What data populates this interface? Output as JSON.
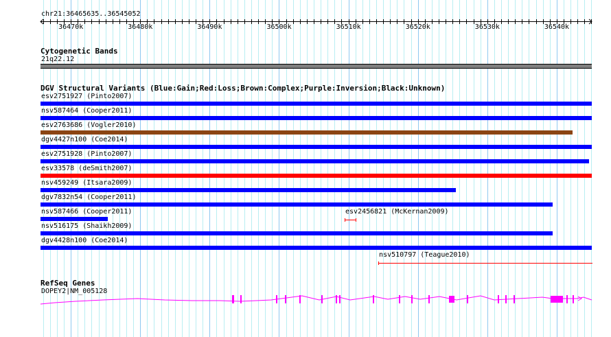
{
  "ruler": {
    "location": "chr21:36465635..36545052",
    "start": 36465635,
    "end": 36545052,
    "ticks": [
      "36470k",
      "36480k",
      "36490k",
      "36500k",
      "36510k",
      "36520k",
      "36530k",
      "36540k"
    ]
  },
  "cyto": {
    "title": "Cytogenetic Bands",
    "band": "21q22.12",
    "color": "#808080"
  },
  "dgv": {
    "title": "DGV Structural Variants (Blue:Gain;Red:Loss;Brown:Complex;Purple:Inversion;Black:Unknown)",
    "colors": {
      "gain": "#0000ff",
      "loss": "#ff0000",
      "complex": "#8b4513"
    },
    "variants": [
      {
        "label": "esv2751927 (Pinto2007)",
        "type": "gain",
        "start": 36465635,
        "end": 36545052,
        "row": 0
      },
      {
        "label": "nsv587464 (Cooper2011)",
        "type": "gain",
        "start": 36465635,
        "end": 36545052,
        "row": 1
      },
      {
        "label": "esv2763686 (Vogler2010)",
        "type": "complex",
        "start": 36465635,
        "end": 36542290,
        "row": 2
      },
      {
        "label": "dgv4427n100 (Coe2014)",
        "type": "gain",
        "start": 36465635,
        "end": 36545052,
        "row": 3
      },
      {
        "label": "esv2751928 (Pinto2007)",
        "type": "gain",
        "start": 36465635,
        "end": 36544660,
        "row": 4
      },
      {
        "label": "esv33578 (deSmith2007)",
        "type": "loss",
        "start": 36465635,
        "end": 36545052,
        "row": 5
      },
      {
        "label": "nsv459249 (Itsara2009)",
        "type": "gain",
        "start": 36465635,
        "end": 36525480,
        "row": 6
      },
      {
        "label": "dgv7832n54 (Cooper2011)",
        "type": "gain",
        "start": 36465635,
        "end": 36539420,
        "row": 7
      },
      {
        "label": "nsv587466 (Cooper2011)",
        "type": "gain",
        "start": 36465635,
        "end": 36475330,
        "row": 8
      },
      {
        "label": "esv2456821 (McKernan2009)",
        "type": "loss",
        "start": 36509450,
        "end": 36510940,
        "row": 8,
        "thin": true
      },
      {
        "label": "nsv516175 (Shaikh2009)",
        "type": "gain",
        "start": 36465635,
        "end": 36539420,
        "row": 9
      },
      {
        "label": "dgv4428n100 (Coe2014)",
        "type": "gain",
        "start": 36465635,
        "end": 36545052,
        "row": 10
      },
      {
        "label": "nsv510797 (Teague2010)",
        "type": "loss",
        "start": 36514300,
        "end": 36545052,
        "row": 11,
        "thin": true
      }
    ]
  },
  "refseq": {
    "title": "RefSeq Genes",
    "gene": "DOPEY2|NM_005128",
    "color": "#ff00ff"
  }
}
